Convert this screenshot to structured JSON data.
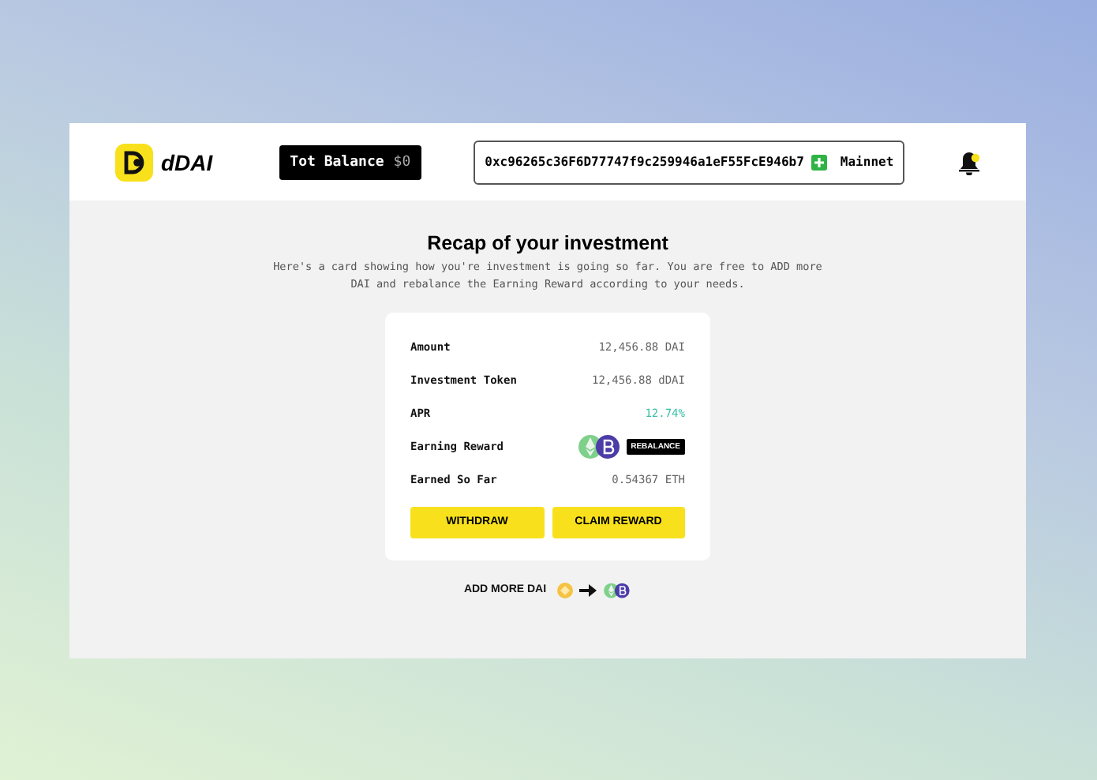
{
  "header": {
    "logo_text": "dDAI",
    "balance_label": "Tot Balance",
    "balance_value": "$0",
    "address": "0xc96265c36F6D77747f9c259946a1eF55FcE946b7",
    "network": "Mainnet"
  },
  "recap": {
    "title": "Recap of your investment",
    "description": "Here's a card showing how you're investment is going so far. You are free to ADD more DAI and rebalance the Earning Reward according to your needs."
  },
  "card": {
    "rows": [
      {
        "kind": "text",
        "label": "Amount",
        "value": "12,456.88 DAI"
      },
      {
        "kind": "text",
        "label": "Investment Token",
        "value": "12,456.88 dDAI"
      },
      {
        "kind": "accent",
        "label": "APR",
        "value": "12.74%"
      },
      {
        "kind": "tokens",
        "label": "Earning Reward",
        "action": "REBALANCE"
      },
      {
        "kind": "text",
        "label": "Earned So Far",
        "value": "0.54367 ETH"
      }
    ],
    "buttons": [
      "WITHDRAW",
      "CLAIM REWARD"
    ]
  },
  "add_more": {
    "label": "ADD MORE DAI"
  }
}
